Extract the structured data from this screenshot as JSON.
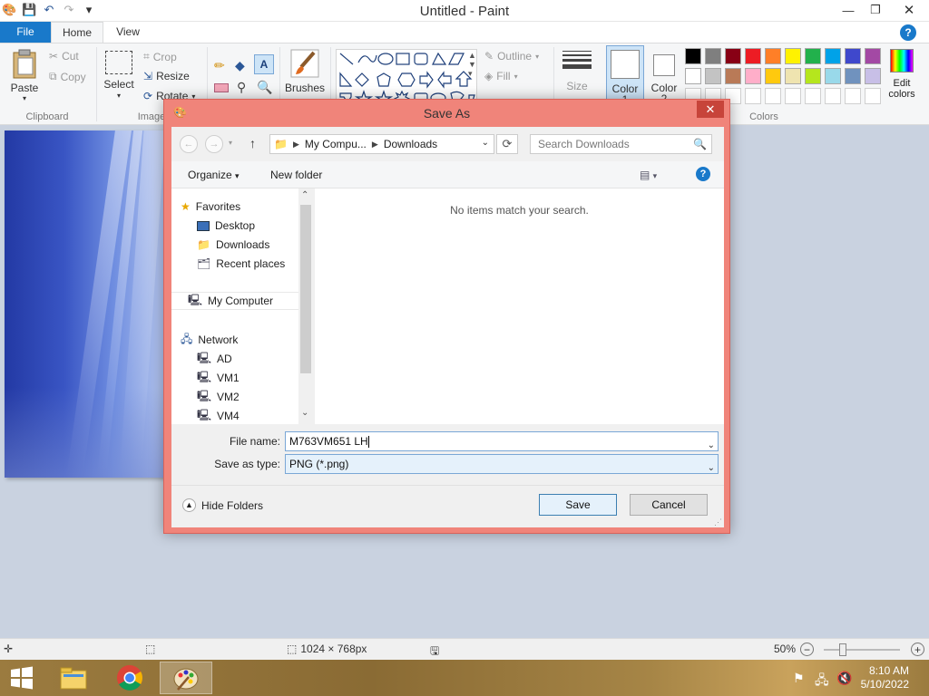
{
  "window": {
    "title": "Untitled - Paint"
  },
  "tabs": {
    "file": "File",
    "home": "Home",
    "view": "View"
  },
  "ribbon": {
    "clipboard": {
      "paste": "Paste",
      "cut": "Cut",
      "copy": "Copy",
      "label": "Clipboard"
    },
    "image": {
      "select": "Select",
      "crop": "Crop",
      "resize": "Resize",
      "rotate": "Rotate",
      "label": "Image"
    },
    "brushes": "Brushes",
    "shapes": {
      "outline": "Outline",
      "fill": "Fill"
    },
    "size": "Size",
    "color1": {
      "line1": "Color",
      "line2": "1"
    },
    "color2": {
      "line1": "Color",
      "line2": "2"
    },
    "edit_colors": {
      "line1": "Edit",
      "line2": "colors"
    },
    "colors_label": "Colors",
    "palette_row1": [
      "#000000",
      "#7f7f7f",
      "#880015",
      "#ed1c24",
      "#ff7f27",
      "#fff200",
      "#22b14c",
      "#00a2e8",
      "#3f48cc",
      "#a349a4"
    ],
    "palette_row2": [
      "#ffffff",
      "#c3c3c3",
      "#b97a57",
      "#ffaec9",
      "#ffc90e",
      "#efe4b0",
      "#b5e61d",
      "#99d9ea",
      "#7092be",
      "#c8bfe7"
    ]
  },
  "status": {
    "dimensions": "1024 × 768px",
    "zoom": "50%"
  },
  "taskbar": {
    "time": "8:10 AM",
    "date": "5/10/2022"
  },
  "dialog": {
    "title": "Save As",
    "address": {
      "part1": "My Compu...",
      "part2": "Downloads"
    },
    "search_placeholder": "Search Downloads",
    "organize": "Organize",
    "new_folder": "New folder",
    "nav": {
      "favorites": "Favorites",
      "desktop": "Desktop",
      "downloads": "Downloads",
      "recent": "Recent places",
      "computer": "My Computer",
      "network": "Network",
      "ad": "AD",
      "vm1": "VM1",
      "vm2": "VM2",
      "vm4": "VM4"
    },
    "empty_message": "No items match your search.",
    "file_name_label": "File name:",
    "file_name_value": "M763VM651 LH",
    "save_type_label": "Save as type:",
    "save_type_value": "PNG (*.png)",
    "hide_folders": "Hide Folders",
    "save": "Save",
    "cancel": "Cancel"
  }
}
